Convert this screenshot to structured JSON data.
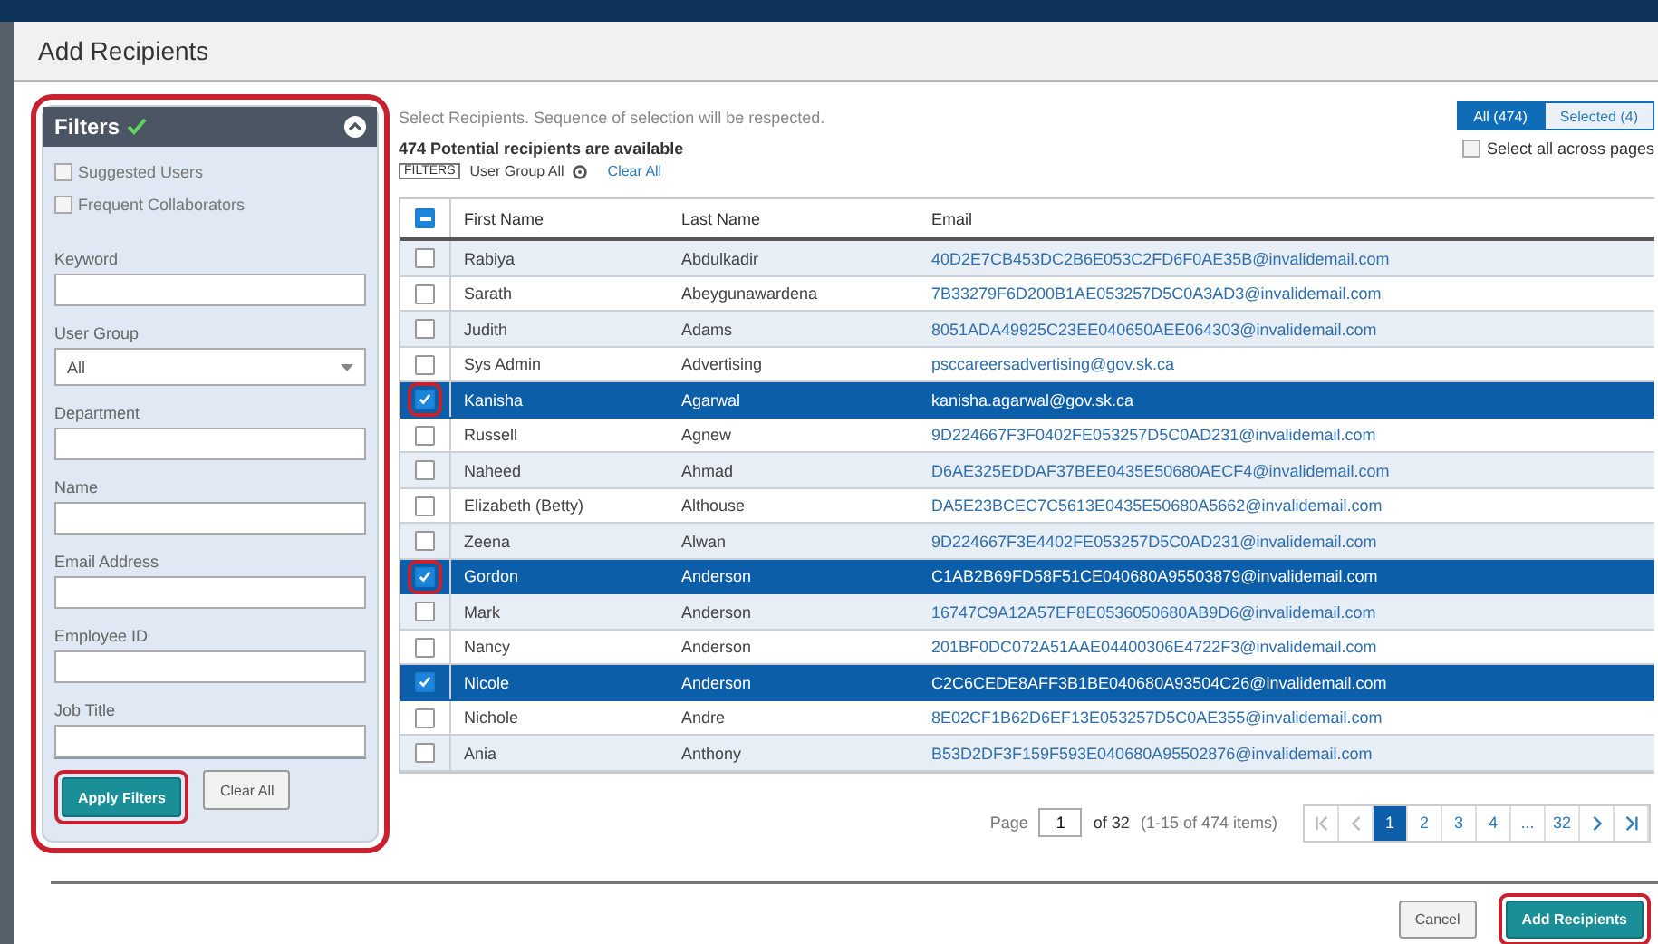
{
  "dialog": {
    "title": "Add Recipients"
  },
  "filters": {
    "title": "Filters",
    "applied": true,
    "expanded": true,
    "highlighted": true,
    "checkboxes": [
      {
        "label": "Suggested Users",
        "checked": false
      },
      {
        "label": "Frequent Collaborators",
        "checked": false
      }
    ],
    "fields": [
      {
        "kind": "text",
        "label": "Keyword"
      },
      {
        "kind": "select",
        "label": "User Group",
        "value": "All"
      },
      {
        "kind": "text",
        "label": "Department"
      },
      {
        "kind": "text",
        "label": "Name"
      },
      {
        "kind": "text",
        "label": "Email Address"
      },
      {
        "kind": "text",
        "label": "Employee ID"
      },
      {
        "kind": "text",
        "label": "Job Title"
      }
    ],
    "apply_button": {
      "label": "Apply Filters",
      "highlighted": true
    },
    "clear_button": {
      "label": "Clear All"
    }
  },
  "instructions": "Select Recipients. Sequence of selection will be respected.",
  "view_tabs": [
    {
      "label": "All (474)",
      "selected": true
    },
    {
      "label": "Selected (4)",
      "selected": false
    }
  ],
  "available_text": "474 Potential recipients are available",
  "select_all_pages": {
    "label": "Select all across pages",
    "checked": false
  },
  "filter_chips": {
    "tag": "FILTERS",
    "chips": [
      "User Group All"
    ],
    "clear": "Clear All"
  },
  "table": {
    "header_partial": true,
    "columns": [
      "First Name",
      "Last Name",
      "Email"
    ],
    "rows": [
      {
        "first": "Rabiya",
        "last": "Abdulkadir",
        "email": "40D2E7CB453DC2B6E053C2FD6F0AE35B@invalidemail.com",
        "selected": false,
        "highlighted": false
      },
      {
        "first": "Sarath",
        "last": "Abeygunawardena",
        "email": "7B33279F6D200B1AE053257D5C0A3AD3@invalidemail.com",
        "selected": false,
        "highlighted": false
      },
      {
        "first": "Judith",
        "last": "Adams",
        "email": "8051ADA49925C23EE040650AEE064303@invalidemail.com",
        "selected": false,
        "highlighted": false
      },
      {
        "first": "Sys Admin",
        "last": "Advertising",
        "email": "psccareersadvertising@gov.sk.ca",
        "selected": false,
        "highlighted": false
      },
      {
        "first": "Kanisha",
        "last": "Agarwal",
        "email": "kanisha.agarwal@gov.sk.ca",
        "selected": true,
        "highlighted": true
      },
      {
        "first": "Russell",
        "last": "Agnew",
        "email": "9D224667F3F0402FE053257D5C0AD231@invalidemail.com",
        "selected": false,
        "highlighted": false
      },
      {
        "first": "Naheed",
        "last": "Ahmad",
        "email": "D6AE325EDDAF37BEE0435E50680AECF4@invalidemail.com",
        "selected": false,
        "highlighted": false
      },
      {
        "first": "Elizabeth (Betty)",
        "last": "Althouse",
        "email": "DA5E23BCEC7C5613E0435E50680A5662@invalidemail.com",
        "selected": false,
        "highlighted": false
      },
      {
        "first": "Zeena",
        "last": "Alwan",
        "email": "9D224667F3E4402FE053257D5C0AD231@invalidemail.com",
        "selected": false,
        "highlighted": false
      },
      {
        "first": "Gordon",
        "last": "Anderson",
        "email": "C1AB2B69FD58F51CE040680A95503879@invalidemail.com",
        "selected": true,
        "highlighted": true
      },
      {
        "first": "Mark",
        "last": "Anderson",
        "email": "16747C9A12A57EF8E0536050680AB9D6@invalidemail.com",
        "selected": false,
        "highlighted": false
      },
      {
        "first": "Nancy",
        "last": "Anderson",
        "email": "201BF0DC072A51AAE04400306E4722F3@invalidemail.com",
        "selected": false,
        "highlighted": false
      },
      {
        "first": "Nicole",
        "last": "Anderson",
        "email": "C2C6CEDE8AFF3B1BE040680A93504C26@invalidemail.com",
        "selected": true,
        "highlighted": false
      },
      {
        "first": "Nichole",
        "last": "Andre",
        "email": "8E02CF1B62D6EF13E053257D5C0AE355@invalidemail.com",
        "selected": false,
        "highlighted": false
      },
      {
        "first": "Ania",
        "last": "Anthony",
        "email": "B53D2DF3F159F593E040680A95502876@invalidemail.com",
        "selected": false,
        "highlighted": false
      }
    ]
  },
  "pagination": {
    "page_label": "Page",
    "page": "1",
    "of": "of 32",
    "range": "(1-15 of 474 items)",
    "buttons": [
      {
        "kind": "first",
        "disabled": true
      },
      {
        "kind": "prev",
        "disabled": true
      },
      {
        "kind": "page",
        "label": "1",
        "selected": true
      },
      {
        "kind": "page",
        "label": "2",
        "selected": false
      },
      {
        "kind": "page",
        "label": "3",
        "selected": false
      },
      {
        "kind": "page",
        "label": "4",
        "selected": false
      },
      {
        "kind": "page",
        "label": "...",
        "selected": false
      },
      {
        "kind": "page",
        "label": "32",
        "selected": false
      },
      {
        "kind": "next",
        "disabled": false
      },
      {
        "kind": "last",
        "disabled": false
      }
    ]
  },
  "footer": {
    "cancel": "Cancel",
    "add": {
      "label": "Add Recipients",
      "highlighted": true
    }
  }
}
